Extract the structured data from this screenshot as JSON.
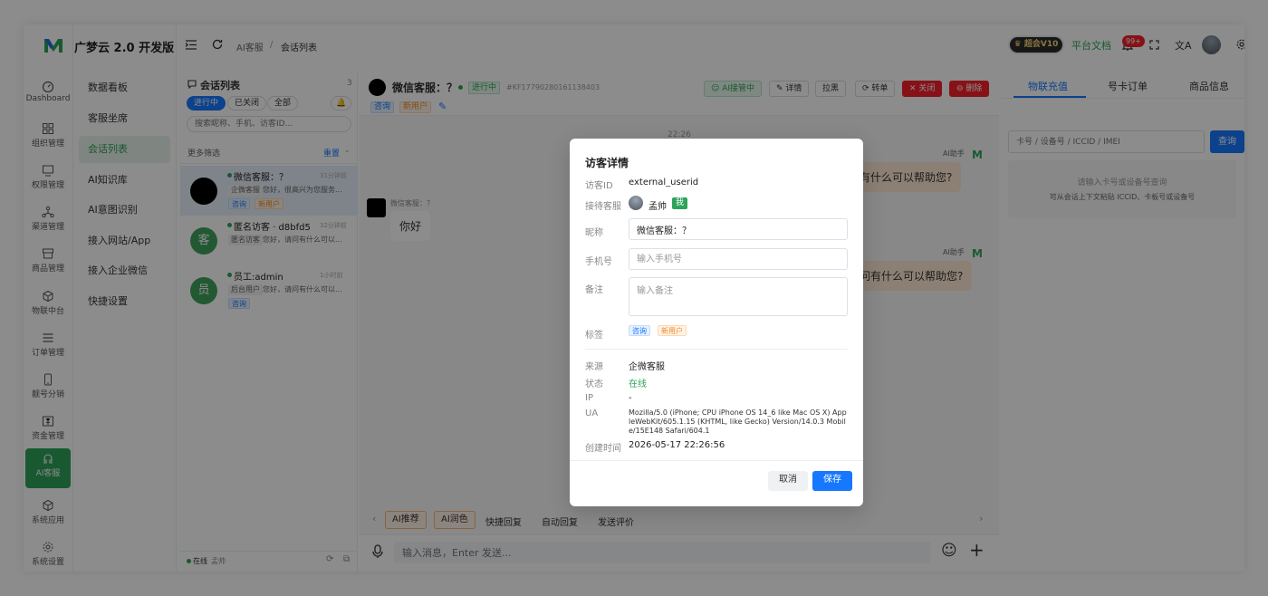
{
  "app": {
    "brand": "广梦云 2.0 开发版",
    "accent": "#2ea35a"
  },
  "rail": [
    {
      "label": "Dashboard",
      "icon": "dashboard-icon"
    },
    {
      "label": "组织管理",
      "icon": "grid-icon"
    },
    {
      "label": "权限管理",
      "icon": "monitor-icon"
    },
    {
      "label": "渠道管理",
      "icon": "channel-icon"
    },
    {
      "label": "商品管理",
      "icon": "store-icon"
    },
    {
      "label": "物联中台",
      "icon": "cube-icon"
    },
    {
      "label": "订单管理",
      "icon": "list-icon"
    },
    {
      "label": "靓号分销",
      "icon": "phone-icon"
    },
    {
      "label": "资金管理",
      "icon": "money-icon"
    },
    {
      "label": "AI客服",
      "icon": "ai-service-icon"
    },
    {
      "label": "系统应用",
      "icon": "apps-icon"
    },
    {
      "label": "系统设置",
      "icon": "gear-icon"
    }
  ],
  "subnav": [
    "数据看板",
    "客服坐席",
    "会话列表",
    "AI知识库",
    "AI意图识别",
    "接入网站/App",
    "接入企业微信",
    "快捷设置"
  ],
  "header": {
    "crumb1": "AI客服",
    "sep": "/",
    "crumb2": "会话列表",
    "vip": "超会V10",
    "docs": "平台文档",
    "badge": "99+"
  },
  "convlist": {
    "title": "会话列表",
    "count": "3",
    "tabs": [
      "进行中",
      "已关闭",
      "全部"
    ],
    "search_placeholder": "搜索昵称、手机、访客ID...",
    "filter": "更多筛选",
    "reset": "重置",
    "items": [
      {
        "name": "微信客服：？",
        "time": "31分钟前",
        "source": "企微客服",
        "preview": "您好，很高兴为您服务...",
        "tags": [
          "咨询",
          "新用户"
        ],
        "avatar": ""
      },
      {
        "name": "匿名访客 · d8bfd5",
        "time": "32分钟前",
        "source": "匿名访客",
        "preview": "您好，请问有什么可以...",
        "tags": [],
        "avatar": "客"
      },
      {
        "name": "员工:admin",
        "time": "1小时前",
        "source": "后台用户",
        "preview": "您好，请问有什么可以...",
        "tags": [
          "咨询"
        ],
        "avatar": "员"
      }
    ],
    "footer_status": "在线",
    "footer_user": "孟帅"
  },
  "chat": {
    "title": "微信客服：？",
    "status": "进行中",
    "conv_id": "#KF17790280161138403",
    "tags": [
      "咨询",
      "新用户"
    ],
    "actions": [
      "AI接管中",
      "详情",
      "拉黑",
      "转单",
      "关闭",
      "删除"
    ],
    "time": "22:26",
    "bot_name": "AI助手",
    "bot_msg1": "问有什么可以帮助您?",
    "visitor_name": "微信客服：？",
    "visitor_msg": "你好",
    "bot_msg2": "请问有什么可以帮助您?",
    "tools": [
      "AI推荐",
      "AI润色",
      "快捷回复",
      "自动回复",
      "发送评价"
    ],
    "input_placeholder": "输入消息，Enter 发送..."
  },
  "right": {
    "tabs": [
      "物联充值",
      "号卡订单",
      "商品信息"
    ],
    "search_placeholder": "卡号 / 设备号 / ICCID / IMEI",
    "search_btn": "查询",
    "hint1": "请输入卡号或设备号查询",
    "hint2": "可从会话上下文粘贴 ICCID、卡板号或设备号"
  },
  "modal": {
    "title": "访客详情",
    "id_label": "访客ID",
    "id_value": "external_userid",
    "agent_label": "接待客服",
    "agent_name": "孟帅",
    "agent_me": "我",
    "nick_label": "昵称",
    "nick_value": "微信客服：？",
    "phone_label": "手机号",
    "phone_placeholder": "输入手机号",
    "remark_label": "备注",
    "remark_placeholder": "输入备注",
    "tag_label": "标签",
    "tags": [
      "咨询",
      "新用户"
    ],
    "source_label": "来源",
    "source_value": "企微客服",
    "state_label": "状态",
    "state_value": "在线",
    "ip_label": "IP",
    "ip_value": "-",
    "ua_label": "UA",
    "ua_value": "Mozilla/5.0 (iPhone; CPU iPhone OS 14_6 like Mac OS X) AppleWebKit/605.1.15 (KHTML, like Gecko) Version/14.0.3 Mobile/15E148 Safari/604.1",
    "created_label": "创建时间",
    "created_value": "2026-05-17 22:26:56",
    "cancel": "取消",
    "save": "保存"
  }
}
